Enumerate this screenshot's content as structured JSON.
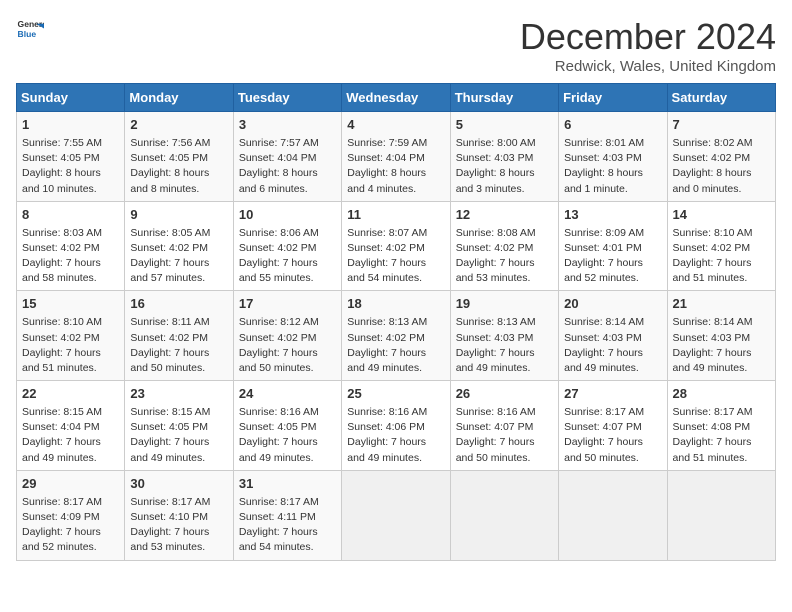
{
  "logo": {
    "line1": "General",
    "line2": "Blue"
  },
  "title": "December 2024",
  "subtitle": "Redwick, Wales, United Kingdom",
  "days_of_week": [
    "Sunday",
    "Monday",
    "Tuesday",
    "Wednesday",
    "Thursday",
    "Friday",
    "Saturday"
  ],
  "weeks": [
    [
      {
        "day": 1,
        "lines": [
          "Sunrise: 7:55 AM",
          "Sunset: 4:05 PM",
          "Daylight: 8 hours",
          "and 10 minutes."
        ]
      },
      {
        "day": 2,
        "lines": [
          "Sunrise: 7:56 AM",
          "Sunset: 4:05 PM",
          "Daylight: 8 hours",
          "and 8 minutes."
        ]
      },
      {
        "day": 3,
        "lines": [
          "Sunrise: 7:57 AM",
          "Sunset: 4:04 PM",
          "Daylight: 8 hours",
          "and 6 minutes."
        ]
      },
      {
        "day": 4,
        "lines": [
          "Sunrise: 7:59 AM",
          "Sunset: 4:04 PM",
          "Daylight: 8 hours",
          "and 4 minutes."
        ]
      },
      {
        "day": 5,
        "lines": [
          "Sunrise: 8:00 AM",
          "Sunset: 4:03 PM",
          "Daylight: 8 hours",
          "and 3 minutes."
        ]
      },
      {
        "day": 6,
        "lines": [
          "Sunrise: 8:01 AM",
          "Sunset: 4:03 PM",
          "Daylight: 8 hours",
          "and 1 minute."
        ]
      },
      {
        "day": 7,
        "lines": [
          "Sunrise: 8:02 AM",
          "Sunset: 4:02 PM",
          "Daylight: 8 hours",
          "and 0 minutes."
        ]
      }
    ],
    [
      {
        "day": 8,
        "lines": [
          "Sunrise: 8:03 AM",
          "Sunset: 4:02 PM",
          "Daylight: 7 hours",
          "and 58 minutes."
        ]
      },
      {
        "day": 9,
        "lines": [
          "Sunrise: 8:05 AM",
          "Sunset: 4:02 PM",
          "Daylight: 7 hours",
          "and 57 minutes."
        ]
      },
      {
        "day": 10,
        "lines": [
          "Sunrise: 8:06 AM",
          "Sunset: 4:02 PM",
          "Daylight: 7 hours",
          "and 55 minutes."
        ]
      },
      {
        "day": 11,
        "lines": [
          "Sunrise: 8:07 AM",
          "Sunset: 4:02 PM",
          "Daylight: 7 hours",
          "and 54 minutes."
        ]
      },
      {
        "day": 12,
        "lines": [
          "Sunrise: 8:08 AM",
          "Sunset: 4:02 PM",
          "Daylight: 7 hours",
          "and 53 minutes."
        ]
      },
      {
        "day": 13,
        "lines": [
          "Sunrise: 8:09 AM",
          "Sunset: 4:01 PM",
          "Daylight: 7 hours",
          "and 52 minutes."
        ]
      },
      {
        "day": 14,
        "lines": [
          "Sunrise: 8:10 AM",
          "Sunset: 4:02 PM",
          "Daylight: 7 hours",
          "and 51 minutes."
        ]
      }
    ],
    [
      {
        "day": 15,
        "lines": [
          "Sunrise: 8:10 AM",
          "Sunset: 4:02 PM",
          "Daylight: 7 hours",
          "and 51 minutes."
        ]
      },
      {
        "day": 16,
        "lines": [
          "Sunrise: 8:11 AM",
          "Sunset: 4:02 PM",
          "Daylight: 7 hours",
          "and 50 minutes."
        ]
      },
      {
        "day": 17,
        "lines": [
          "Sunrise: 8:12 AM",
          "Sunset: 4:02 PM",
          "Daylight: 7 hours",
          "and 50 minutes."
        ]
      },
      {
        "day": 18,
        "lines": [
          "Sunrise: 8:13 AM",
          "Sunset: 4:02 PM",
          "Daylight: 7 hours",
          "and 49 minutes."
        ]
      },
      {
        "day": 19,
        "lines": [
          "Sunrise: 8:13 AM",
          "Sunset: 4:03 PM",
          "Daylight: 7 hours",
          "and 49 minutes."
        ]
      },
      {
        "day": 20,
        "lines": [
          "Sunrise: 8:14 AM",
          "Sunset: 4:03 PM",
          "Daylight: 7 hours",
          "and 49 minutes."
        ]
      },
      {
        "day": 21,
        "lines": [
          "Sunrise: 8:14 AM",
          "Sunset: 4:03 PM",
          "Daylight: 7 hours",
          "and 49 minutes."
        ]
      }
    ],
    [
      {
        "day": 22,
        "lines": [
          "Sunrise: 8:15 AM",
          "Sunset: 4:04 PM",
          "Daylight: 7 hours",
          "and 49 minutes."
        ]
      },
      {
        "day": 23,
        "lines": [
          "Sunrise: 8:15 AM",
          "Sunset: 4:05 PM",
          "Daylight: 7 hours",
          "and 49 minutes."
        ]
      },
      {
        "day": 24,
        "lines": [
          "Sunrise: 8:16 AM",
          "Sunset: 4:05 PM",
          "Daylight: 7 hours",
          "and 49 minutes."
        ]
      },
      {
        "day": 25,
        "lines": [
          "Sunrise: 8:16 AM",
          "Sunset: 4:06 PM",
          "Daylight: 7 hours",
          "and 49 minutes."
        ]
      },
      {
        "day": 26,
        "lines": [
          "Sunrise: 8:16 AM",
          "Sunset: 4:07 PM",
          "Daylight: 7 hours",
          "and 50 minutes."
        ]
      },
      {
        "day": 27,
        "lines": [
          "Sunrise: 8:17 AM",
          "Sunset: 4:07 PM",
          "Daylight: 7 hours",
          "and 50 minutes."
        ]
      },
      {
        "day": 28,
        "lines": [
          "Sunrise: 8:17 AM",
          "Sunset: 4:08 PM",
          "Daylight: 7 hours",
          "and 51 minutes."
        ]
      }
    ],
    [
      {
        "day": 29,
        "lines": [
          "Sunrise: 8:17 AM",
          "Sunset: 4:09 PM",
          "Daylight: 7 hours",
          "and 52 minutes."
        ]
      },
      {
        "day": 30,
        "lines": [
          "Sunrise: 8:17 AM",
          "Sunset: 4:10 PM",
          "Daylight: 7 hours",
          "and 53 minutes."
        ]
      },
      {
        "day": 31,
        "lines": [
          "Sunrise: 8:17 AM",
          "Sunset: 4:11 PM",
          "Daylight: 7 hours",
          "and 54 minutes."
        ]
      },
      null,
      null,
      null,
      null
    ]
  ]
}
